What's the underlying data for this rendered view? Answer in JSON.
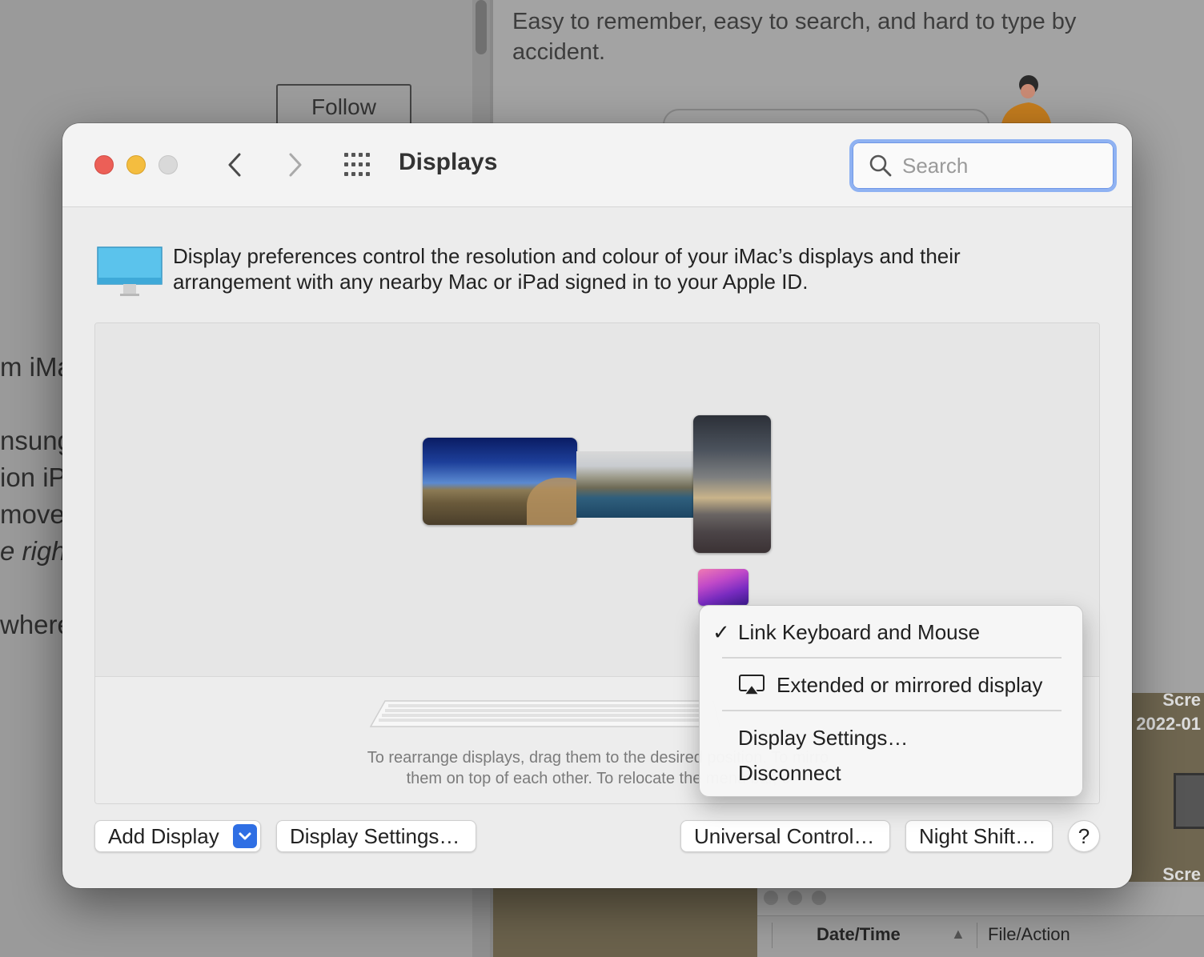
{
  "background": {
    "article_text": "Easy to remember, easy to search, and hard to type by accident.",
    "follow_label": "Follow",
    "left_snippets": [
      "m iMa",
      "nsung",
      "ion iP",
      "move",
      "e right",
      "where"
    ],
    "photo_labels": [
      "Scre",
      "2022-01",
      "Scre"
    ],
    "finder": {
      "col_date": "Date/Time",
      "col_file": "File/Action",
      "sort_indicator": "▲"
    }
  },
  "window": {
    "title": "Displays",
    "search_placeholder": "Search",
    "intro": "Display preferences control the resolution and colour of your iMac’s displays and their arrangement with any nearby Mac or iPad signed in to your Apple ID.",
    "help_text_line1": "To rearrange displays, drag them to the desired position. To mirro",
    "help_text_line2": "them on top of each other. To relocate the menu bar, c",
    "buttons": {
      "add_display": "Add Display",
      "display_settings": "Display Settings…",
      "universal_control": "Universal Control…",
      "night_shift": "Night Shift…",
      "help": "?"
    }
  },
  "context_menu": {
    "items": [
      {
        "label": "Link Keyboard and Mouse",
        "checked": "✓"
      },
      {
        "label": "Extended or mirrored display"
      },
      {
        "label": "Display Settings…"
      },
      {
        "label": "Disconnect"
      }
    ]
  },
  "colors": {
    "accent": "#2f6fe4",
    "close": "#ec5f57",
    "minimize": "#f4bd3f",
    "search_focus": "#8fb2f2"
  },
  "icons": [
    "back-chevron-icon",
    "forward-chevron-icon",
    "grid-icon",
    "search-icon",
    "imac-icon",
    "airplay-icon",
    "checkmark-icon",
    "chevron-down-icon"
  ]
}
